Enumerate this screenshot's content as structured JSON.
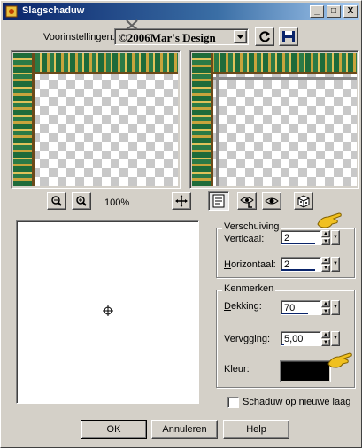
{
  "window": {
    "title": "Slagschaduw",
    "controls": {
      "minimize": "_",
      "maximize": "□",
      "close": "X"
    }
  },
  "presets": {
    "label": "Voorinstellingen:",
    "selected": "©2006Mar's Design"
  },
  "zoom": {
    "level": "100%"
  },
  "offset_group": {
    "title": "Verschuiving",
    "vertical_label": "Verticaal:",
    "vertical_value": "2",
    "horizontal_label": "Horizontaal:",
    "horizontal_value": "2"
  },
  "properties_group": {
    "title": "Kenmerken",
    "opacity_label": "Dekking:",
    "opacity_value": "70",
    "blur_label": "Vervaging:",
    "blur_value": "5,00",
    "color_label": "Kleur:",
    "color": "#000000"
  },
  "new_layer_checkbox": {
    "label": "Schaduw op nieuwe laag",
    "checked": false
  },
  "buttons": {
    "ok": "OK",
    "cancel": "Annuleren",
    "help": "Help"
  },
  "colors": {
    "titlebar": "#0a246a",
    "face": "#d4d0c8",
    "accent": "#0a246a"
  },
  "icons": [
    "app-icon",
    "zoom-out-icon",
    "zoom-in-icon",
    "pan-icon",
    "proof-icon",
    "hide-original-icon",
    "show-original-icon",
    "randomize-icon",
    "reset-icon",
    "save-icon",
    "dropdown-arrow-icon",
    "pointing-hand-icon"
  ]
}
